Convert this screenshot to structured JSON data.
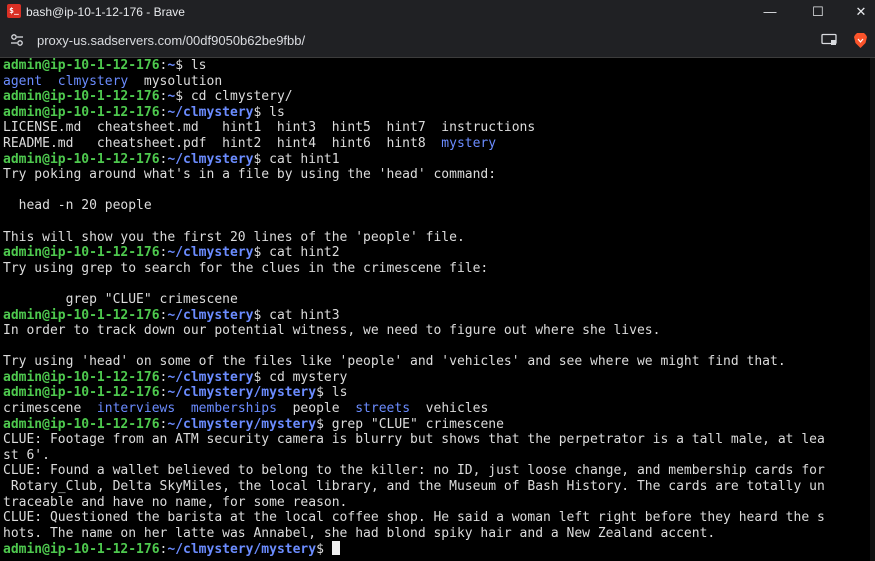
{
  "window": {
    "title": "bash@ip-10-1-12-176 - Brave",
    "icon_text": "$_"
  },
  "window_controls": {
    "minimize": "—",
    "maximize": "☐",
    "close": "✕"
  },
  "address": {
    "url": "proxy-us.sadservers.com/00df9050b62be9fbb/"
  },
  "colors": {
    "prompt_user": "#4ec94e",
    "prompt_path": "#6b8cff",
    "directory": "#6b8cff",
    "text": "#dcdcdc",
    "background": "#000000"
  },
  "terminal": {
    "lines": [
      [
        {
          "t": "admin@ip-10-1-12-176",
          "c": "pu"
        },
        {
          "t": ":"
        },
        {
          "t": "~",
          "c": "pp"
        },
        {
          "t": "$ ls"
        }
      ],
      [
        {
          "t": "agent",
          "c": "d"
        },
        {
          "t": "  "
        },
        {
          "t": "clmystery",
          "c": "d"
        },
        {
          "t": "  mysolution"
        }
      ],
      [
        {
          "t": "admin@ip-10-1-12-176",
          "c": "pu"
        },
        {
          "t": ":"
        },
        {
          "t": "~",
          "c": "pp"
        },
        {
          "t": "$ cd clmystery/"
        }
      ],
      [
        {
          "t": "admin@ip-10-1-12-176",
          "c": "pu"
        },
        {
          "t": ":"
        },
        {
          "t": "~/clmystery",
          "c": "pp"
        },
        {
          "t": "$ ls"
        }
      ],
      [
        {
          "t": "LICENSE.md  cheatsheet.md   hint1  hint3  hint5  hint7  instructions"
        }
      ],
      [
        {
          "t": "README.md   cheatsheet.pdf  hint2  hint4  hint6  hint8  "
        },
        {
          "t": "mystery",
          "c": "d"
        }
      ],
      [
        {
          "t": "admin@ip-10-1-12-176",
          "c": "pu"
        },
        {
          "t": ":"
        },
        {
          "t": "~/clmystery",
          "c": "pp"
        },
        {
          "t": "$ cat hint1"
        }
      ],
      [
        {
          "t": "Try poking around what's in a file by using the 'head' command:"
        }
      ],
      [
        {
          "t": ""
        }
      ],
      [
        {
          "t": "  head -n 20 people"
        }
      ],
      [
        {
          "t": ""
        }
      ],
      [
        {
          "t": "This will show you the first 20 lines of the 'people' file."
        }
      ],
      [
        {
          "t": "admin@ip-10-1-12-176",
          "c": "pu"
        },
        {
          "t": ":"
        },
        {
          "t": "~/clmystery",
          "c": "pp"
        },
        {
          "t": "$ cat hint2"
        }
      ],
      [
        {
          "t": "Try using grep to search for the clues in the crimescene file:"
        }
      ],
      [
        {
          "t": ""
        }
      ],
      [
        {
          "t": "        grep \"CLUE\" crimescene"
        }
      ],
      [
        {
          "t": "admin@ip-10-1-12-176",
          "c": "pu"
        },
        {
          "t": ":"
        },
        {
          "t": "~/clmystery",
          "c": "pp"
        },
        {
          "t": "$ cat hint3"
        }
      ],
      [
        {
          "t": "In order to track down our potential witness, we need to figure out where she lives."
        }
      ],
      [
        {
          "t": ""
        }
      ],
      [
        {
          "t": "Try using 'head' on some of the files like 'people' and 'vehicles' and see where we might find that."
        }
      ],
      [
        {
          "t": "admin@ip-10-1-12-176",
          "c": "pu"
        },
        {
          "t": ":"
        },
        {
          "t": "~/clmystery",
          "c": "pp"
        },
        {
          "t": "$ cd mystery"
        }
      ],
      [
        {
          "t": "admin@ip-10-1-12-176",
          "c": "pu"
        },
        {
          "t": ":"
        },
        {
          "t": "~/clmystery/mystery",
          "c": "pp"
        },
        {
          "t": "$ ls"
        }
      ],
      [
        {
          "t": "crimescene  "
        },
        {
          "t": "interviews",
          "c": "d"
        },
        {
          "t": "  "
        },
        {
          "t": "memberships",
          "c": "d"
        },
        {
          "t": "  people  "
        },
        {
          "t": "streets",
          "c": "d"
        },
        {
          "t": "  vehicles"
        }
      ],
      [
        {
          "t": "admin@ip-10-1-12-176",
          "c": "pu"
        },
        {
          "t": ":"
        },
        {
          "t": "~/clmystery/mystery",
          "c": "pp"
        },
        {
          "t": "$ grep \"CLUE\" crimescene"
        }
      ],
      [
        {
          "t": "CLUE: Footage from an ATM security camera is blurry but shows that the perpetrator is a tall male, at lea"
        }
      ],
      [
        {
          "t": "st 6'."
        }
      ],
      [
        {
          "t": "CLUE: Found a wallet believed to belong to the killer: no ID, just loose change, and membership cards for"
        }
      ],
      [
        {
          "t": " Rotary_Club, Delta SkyMiles, the local library, and the Museum of Bash History. The cards are totally un"
        }
      ],
      [
        {
          "t": "traceable and have no name, for some reason."
        }
      ],
      [
        {
          "t": "CLUE: Questioned the barista at the local coffee shop. He said a woman left right before they heard the s"
        }
      ],
      [
        {
          "t": "hots. The name on her latte was Annabel, she had blond spiky hair and a New Zealand accent."
        }
      ],
      [
        {
          "t": "admin@ip-10-1-12-176",
          "c": "pu"
        },
        {
          "t": ":"
        },
        {
          "t": "~/clmystery/mystery",
          "c": "pp"
        },
        {
          "t": "$ "
        }
      ]
    ]
  }
}
